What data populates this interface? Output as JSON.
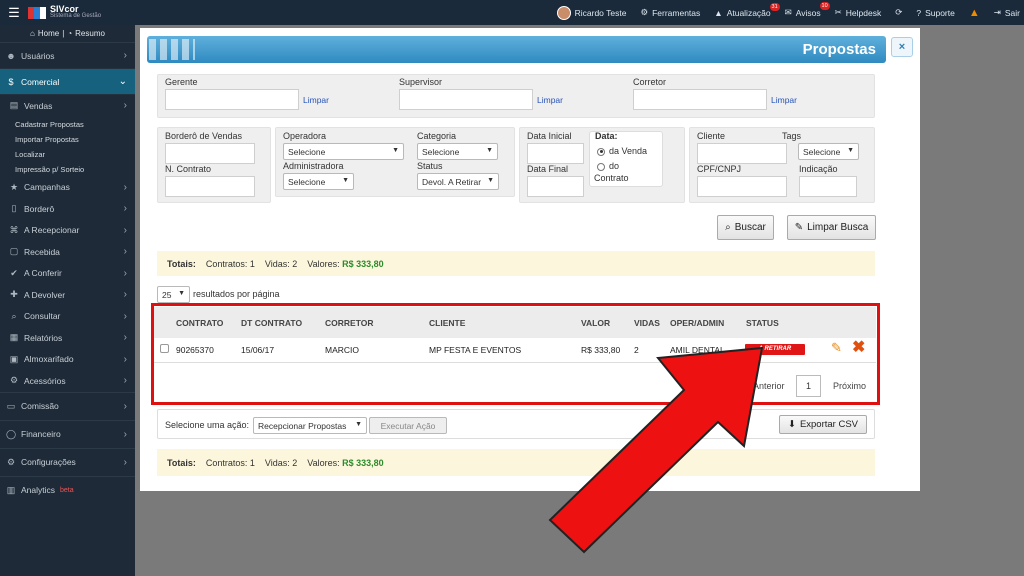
{
  "topbar": {
    "menu_icon": "hamburger-icon",
    "logo_title": "SIVcor",
    "logo_sub": "Sistema de Gestão",
    "user": "Ricardo Teste",
    "tools": "Ferramentas",
    "update": "Atualização",
    "update_badge": "31",
    "notices": "Avisos",
    "notices_badge": "10",
    "helpdesk": "Helpdesk",
    "support": "Suporte",
    "exit": "Sair"
  },
  "sidebar": {
    "home": "Home",
    "summary": "Resumo",
    "items": [
      "Usuários",
      "Comercial"
    ],
    "vendas": "Vendas",
    "vendas_leaves": [
      "Cadastrar Propostas",
      "Importar Propostas",
      "Localizar",
      "Impressão p/ Sorteio"
    ],
    "subs": [
      "Campanhas",
      "Borderô",
      "A Recepcionar",
      "Recebida",
      "A Conferir",
      "A Devolver",
      "Consultar",
      "Relatórios",
      "Almoxarifado",
      "Acessórios"
    ],
    "bottom": [
      "Comissão",
      "Financeiro",
      "Configurações",
      "Analytics"
    ],
    "beta": "beta"
  },
  "modal": {
    "title": "Propostas",
    "close": "×"
  },
  "filters": {
    "gerente": "Gerente",
    "supervisor": "Supervisor",
    "corretor": "Corretor",
    "limpar": "Limpar",
    "bordero": "Borderô de Vendas",
    "n_contrato": "N. Contrato",
    "operadora": "Operadora",
    "operadora_val": "Selecione",
    "administradora": "Administradora",
    "administradora_val": "Selecione",
    "categoria": "Categoria",
    "categoria_val": "Selecione",
    "status": "Status",
    "status_val": "Devol. A Retirar",
    "data_inicial": "Data Inicial",
    "data_final": "Data Final",
    "data": "Data:",
    "da_venda": "da Venda",
    "do_contrato_1": "do",
    "do_contrato_2": "Contrato",
    "cliente": "Cliente",
    "tags": "Tags",
    "tags_val": "Selecione",
    "cpf": "CPF/CNPJ",
    "indicacao": "Indicação",
    "buscar": "Buscar",
    "limpar_busca": "Limpar Busca"
  },
  "totals": {
    "label": "Totais:",
    "contratos": "Contratos: 1",
    "vidas": "Vidas: 2",
    "valores": "Valores:",
    "valor": "R$ 333,80"
  },
  "page_size": {
    "value": "25",
    "label": "resultados por página"
  },
  "table": {
    "headers": [
      "CONTRATO",
      "DT CONTRATO",
      "CORRETOR",
      "CLIENTE",
      "VALOR",
      "VIDAS",
      "OPER/ADMIN",
      "STATUS"
    ],
    "row": {
      "contrato": "90265370",
      "dt": "15/06/17",
      "corretor": "MARCIO",
      "cliente": "MP FESTA E EVENTOS",
      "valor": "R$ 333,80",
      "vidas": "2",
      "oper": "AMIL DENTAL",
      "status": "A RETIRAR"
    }
  },
  "pager": {
    "prev": "Anterior",
    "page": "1",
    "next": "Próximo"
  },
  "actions": {
    "label": "Selecione uma ação:",
    "select": "Recepcionar Propostas",
    "execute": "Executar Ação",
    "export": "Exportar CSV"
  },
  "colors": {
    "accent": "#2f8ac0",
    "highlight": "#e01010"
  }
}
